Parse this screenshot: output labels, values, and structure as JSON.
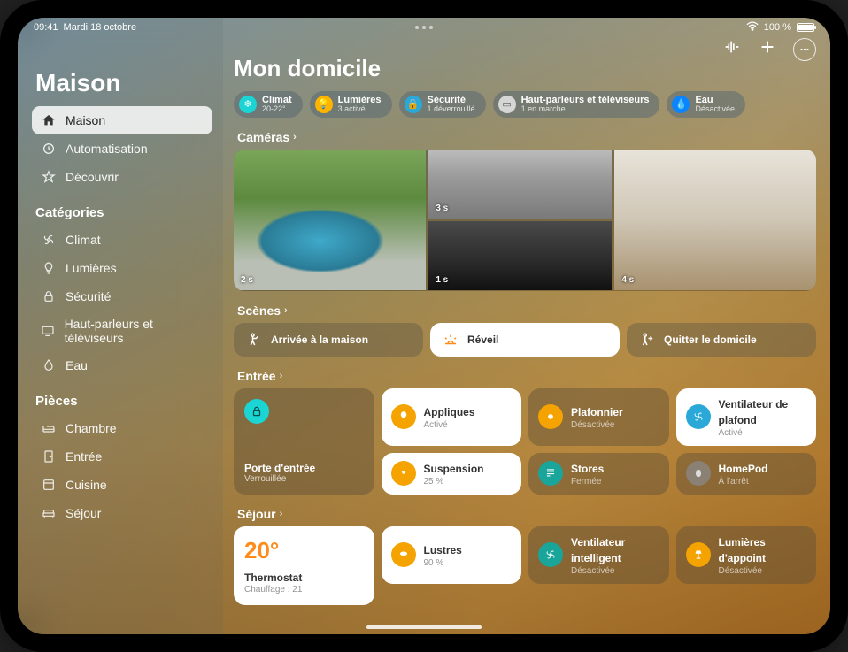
{
  "statusbar": {
    "time": "09:41",
    "date": "Mardi 18 octobre",
    "battery_pct": "100 %",
    "wifi": true
  },
  "sidebar": {
    "title": "Maison",
    "primary": [
      {
        "label": "Maison",
        "icon": "house"
      },
      {
        "label": "Automatisation",
        "icon": "clock-cycle"
      },
      {
        "label": "Découvrir",
        "icon": "star"
      }
    ],
    "categories_header": "Catégories",
    "categories": [
      {
        "label": "Climat",
        "icon": "fan"
      },
      {
        "label": "Lumières",
        "icon": "bulb"
      },
      {
        "label": "Sécurité",
        "icon": "lock"
      },
      {
        "label": "Haut-parleurs et téléviseurs",
        "icon": "tv"
      },
      {
        "label": "Eau",
        "icon": "drop"
      }
    ],
    "rooms_header": "Pièces",
    "rooms": [
      {
        "label": "Chambre",
        "icon": "bed"
      },
      {
        "label": "Entrée",
        "icon": "door"
      },
      {
        "label": "Cuisine",
        "icon": "oven"
      },
      {
        "label": "Séjour",
        "icon": "sofa"
      }
    ]
  },
  "page": {
    "title": "Mon domicile",
    "status_pills": [
      {
        "title": "Climat",
        "subtitle": "20-22°",
        "color": "#1bd4d4",
        "icon": "snowflake"
      },
      {
        "title": "Lumières",
        "subtitle": "3 activé",
        "color": "#ffb400",
        "icon": "bulb"
      },
      {
        "title": "Sécurité",
        "subtitle": "1 déverrouillé",
        "color": "#2aa8d8",
        "icon": "lock"
      },
      {
        "title": "Haut-parleurs et téléviseurs",
        "subtitle": "1 en marche",
        "color": "#d6d6d6",
        "icon": "tv"
      },
      {
        "title": "Eau",
        "subtitle": "Désactivée",
        "color": "#0a84ff",
        "icon": "drop"
      }
    ],
    "cameras_header": "Caméras",
    "cameras": [
      {
        "timestamp": "2 s"
      },
      {
        "timestamp": "3 s"
      },
      {
        "timestamp": "1 s"
      },
      {
        "timestamp": "4 s"
      }
    ],
    "scenes_header": "Scènes",
    "scenes": [
      {
        "label": "Arrivée à la maison",
        "icon": "person-in",
        "active": false
      },
      {
        "label": "Réveil",
        "icon": "sunrise",
        "active": true
      },
      {
        "label": "Quitter le domicile",
        "icon": "person-out",
        "active": false
      }
    ],
    "entree": {
      "header": "Entrée",
      "door": {
        "name": "Porte d'entrée",
        "state": "Verrouillée",
        "color": "#18c9c0"
      },
      "tiles": [
        {
          "name": "Appliques",
          "state": "Activé",
          "lit": true,
          "color": "#f4a300",
          "icon": "bulb"
        },
        {
          "name": "Plafonnier",
          "state": "Désactivée",
          "lit": false,
          "color": "#f4a300",
          "icon": "bulb"
        },
        {
          "name": "Ventilateur de plafond",
          "state": "Activé",
          "lit": true,
          "color": "#10b3d6",
          "icon": "fan"
        },
        {
          "name": "Suspension",
          "state": "25 %",
          "lit": true,
          "color": "#f4a300",
          "icon": "bulb"
        },
        {
          "name": "Stores",
          "state": "Fermée",
          "lit": false,
          "color": "#1aa59b",
          "icon": "blinds"
        },
        {
          "name": "HomePod",
          "state": "À l'arrêt",
          "lit": false,
          "color": "#8a8074",
          "icon": "homepod"
        }
      ]
    },
    "sejour": {
      "header": "Séjour",
      "thermostat": {
        "temp": "20°",
        "name": "Thermostat",
        "state": "Chauffage : 21"
      },
      "tiles": [
        {
          "name": "Lustres",
          "state": "90 %",
          "lit": true,
          "color": "#f4a300",
          "icon": "bulb-wide"
        },
        {
          "name": "Ventilateur intelligent",
          "state": "Désactivée",
          "lit": false,
          "color": "#1aa59b",
          "icon": "fan"
        },
        {
          "name": "Lumières d'appoint",
          "state": "Désactivée",
          "lit": false,
          "color": "#f4a300",
          "icon": "lamp"
        }
      ]
    }
  }
}
